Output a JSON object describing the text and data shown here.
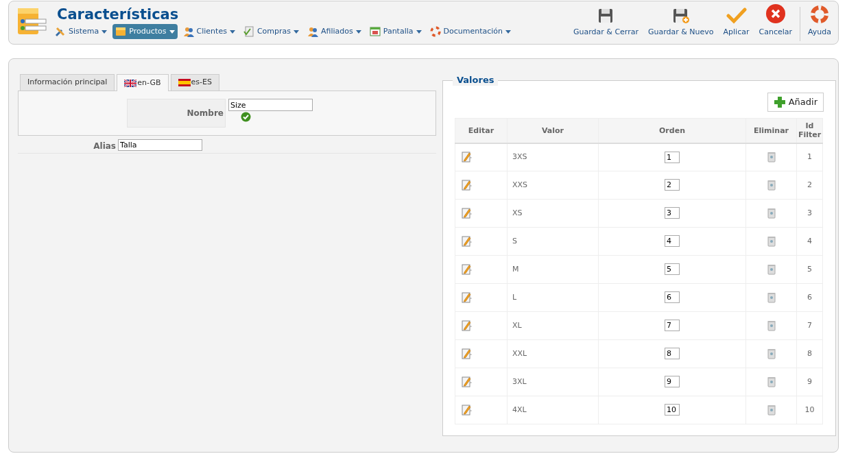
{
  "header": {
    "title": "Características"
  },
  "menu": [
    {
      "label": "Sistema",
      "kind": "tools",
      "selected": false
    },
    {
      "label": "Productos",
      "kind": "box",
      "selected": true
    },
    {
      "label": "Clientes",
      "kind": "people",
      "selected": false
    },
    {
      "label": "Compras",
      "kind": "doc",
      "selected": false
    },
    {
      "label": "Afiliados",
      "kind": "people",
      "selected": false
    },
    {
      "label": "Pantalla",
      "kind": "screen",
      "selected": false
    },
    {
      "label": "Documentación",
      "kind": "ring",
      "selected": false
    }
  ],
  "toolbar": [
    {
      "label": "Guardar & Cerrar",
      "kind": "save"
    },
    {
      "label": "Guardar & Nuevo",
      "kind": "savenew"
    },
    {
      "label": "Aplicar",
      "kind": "apply"
    },
    {
      "label": "Cancelar",
      "kind": "cancel"
    },
    {
      "label": "Ayuda",
      "kind": "help"
    }
  ],
  "tabs": [
    {
      "label": "Información principal",
      "kind": "plain",
      "selected": false
    },
    {
      "label": "en-GB",
      "kind": "gb",
      "selected": true
    },
    {
      "label": "es-ES",
      "kind": "es",
      "selected": false
    }
  ],
  "form": {
    "name_label": "Nombre",
    "name_value": "Size",
    "name_valid": true,
    "alias_label": "Alias",
    "alias_value": "Talla"
  },
  "values": {
    "legend": "Valores",
    "add_button": "Añadir",
    "columns": [
      "Editar",
      "Valor",
      "Orden",
      "Eliminar",
      "Id Filter"
    ],
    "rows": [
      {
        "valor": "3XS",
        "orden": "1",
        "id": "1"
      },
      {
        "valor": "XXS",
        "orden": "2",
        "id": "2"
      },
      {
        "valor": "XS",
        "orden": "3",
        "id": "3"
      },
      {
        "valor": "S",
        "orden": "4",
        "id": "4"
      },
      {
        "valor": "M",
        "orden": "5",
        "id": "5"
      },
      {
        "valor": "L",
        "orden": "6",
        "id": "6"
      },
      {
        "valor": "XL",
        "orden": "7",
        "id": "7"
      },
      {
        "valor": "XXL",
        "orden": "8",
        "id": "8"
      },
      {
        "valor": "3XL",
        "orden": "9",
        "id": "9"
      },
      {
        "valor": "4XL",
        "orden": "10",
        "id": "10"
      }
    ]
  }
}
